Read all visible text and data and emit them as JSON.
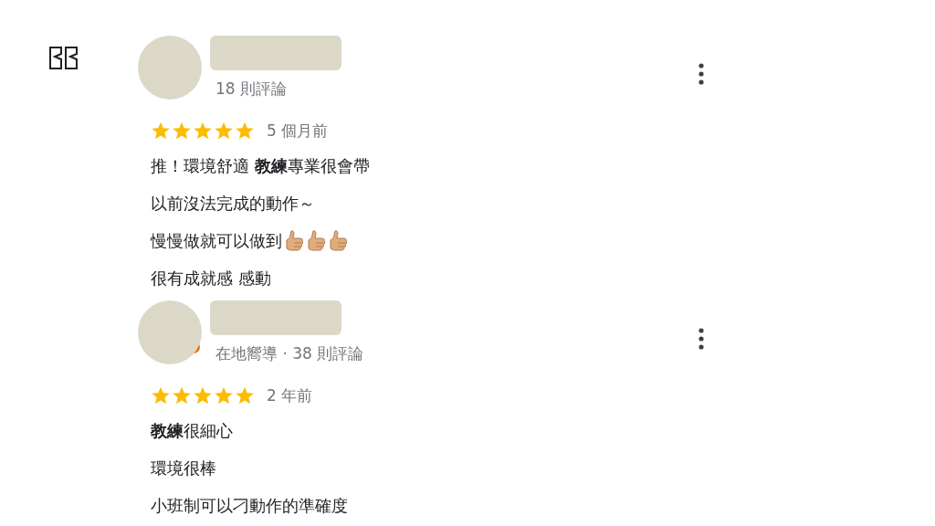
{
  "reviews": [
    {
      "local_guide": false,
      "meta": "18 則評論",
      "stars": 5,
      "time": "5 個月前",
      "lines": [
        {
          "text": "推！環境舒適 **教練**專業很會帶"
        },
        {
          "text": "以前沒法完成的動作～"
        },
        {
          "text": "慢慢做就可以做到",
          "icons": [
            {
              "kind": "thumbs-up"
            },
            {
              "kind": "thumbs-up"
            },
            {
              "kind": "thumbs-up"
            }
          ]
        },
        {
          "text": "很有成就感 感動"
        }
      ]
    },
    {
      "local_guide": true,
      "meta": "在地嚮導 · 38 則評論",
      "stars": 5,
      "time": "2 年前",
      "lines": [
        {
          "text": "**教練**很細心"
        },
        {
          "text": "環境很棒"
        },
        {
          "text": "小班制可以刁動作的準確度"
        }
      ]
    }
  ]
}
